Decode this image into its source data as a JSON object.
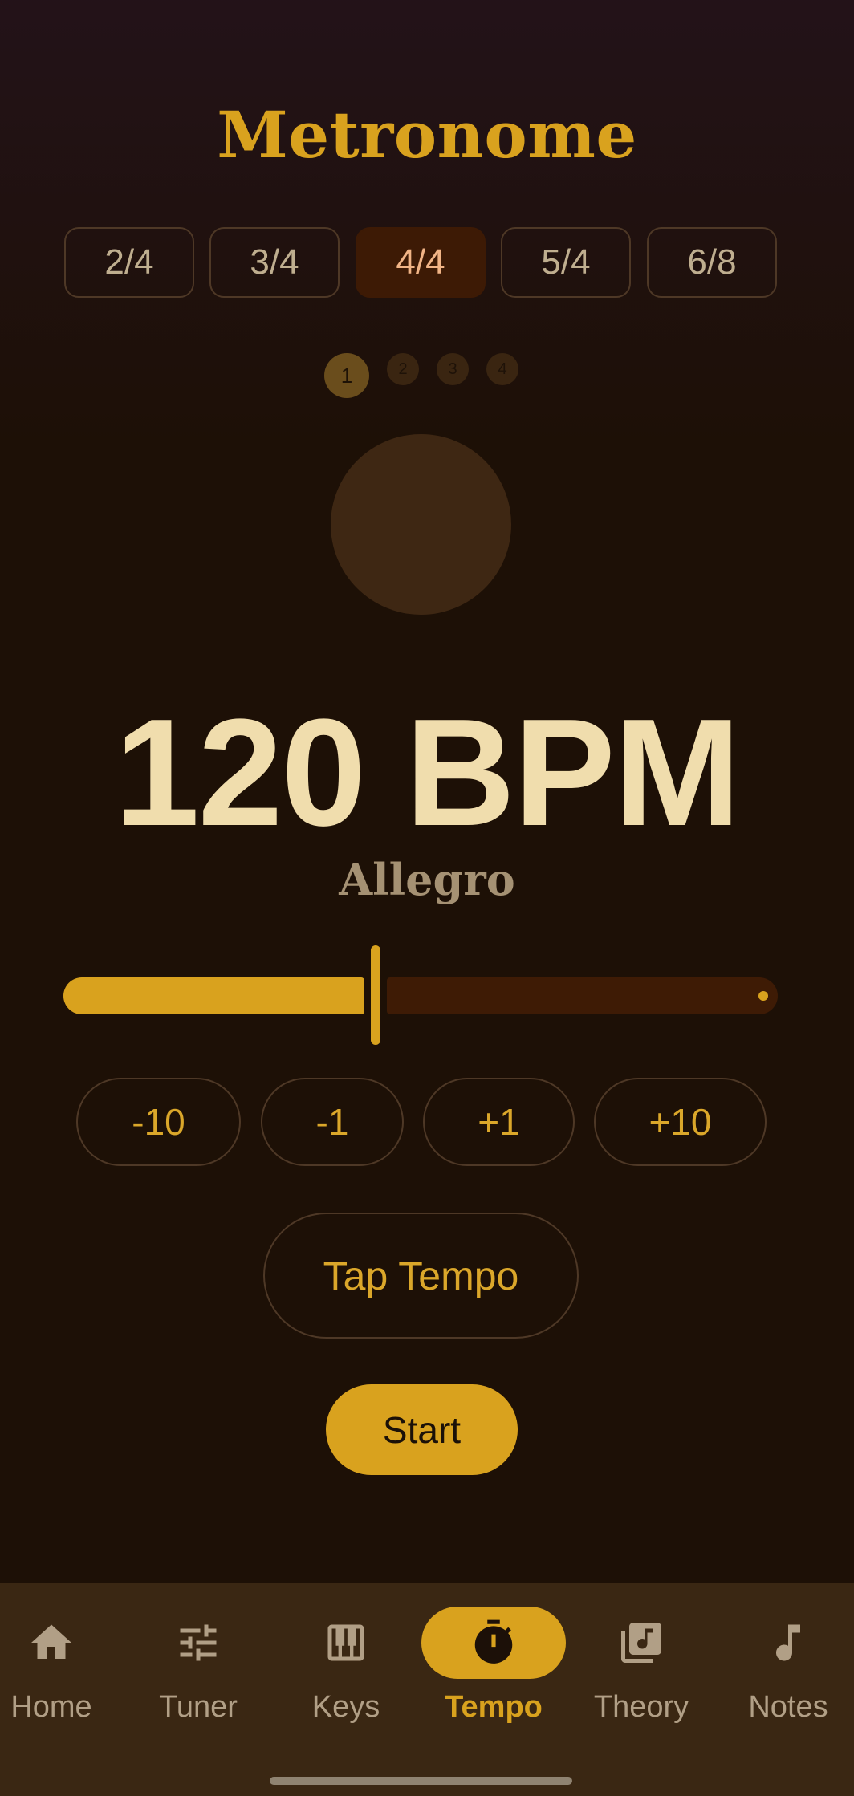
{
  "title": "Metronome",
  "time_signatures": [
    {
      "label": "2/4",
      "active": false
    },
    {
      "label": "3/4",
      "active": false
    },
    {
      "label": "4/4",
      "active": true
    },
    {
      "label": "5/4",
      "active": false
    },
    {
      "label": "6/8",
      "active": false
    }
  ],
  "beats": [
    "1",
    "2",
    "3",
    "4"
  ],
  "bpm_display": "120 BPM",
  "tempo_marking": "Allegro",
  "tempo_slider": {
    "value": 120,
    "fraction": 0.4
  },
  "steppers": [
    "-10",
    "-1",
    "+1",
    "+10"
  ],
  "tap_tempo_label": "Tap Tempo",
  "start_label": "Start",
  "nav": [
    {
      "label": "Home",
      "icon": "home-icon",
      "active": false
    },
    {
      "label": "Tuner",
      "icon": "tune-icon",
      "active": false
    },
    {
      "label": "Keys",
      "icon": "piano-icon",
      "active": false
    },
    {
      "label": "Tempo",
      "icon": "timer-icon",
      "active": true
    },
    {
      "label": "Theory",
      "icon": "library-music-icon",
      "active": false
    },
    {
      "label": "Notes",
      "icon": "music-note-icon",
      "active": false
    }
  ],
  "colors": {
    "accent": "#d9a21e",
    "background": "#1d1006",
    "nav_background": "#3a2713"
  }
}
